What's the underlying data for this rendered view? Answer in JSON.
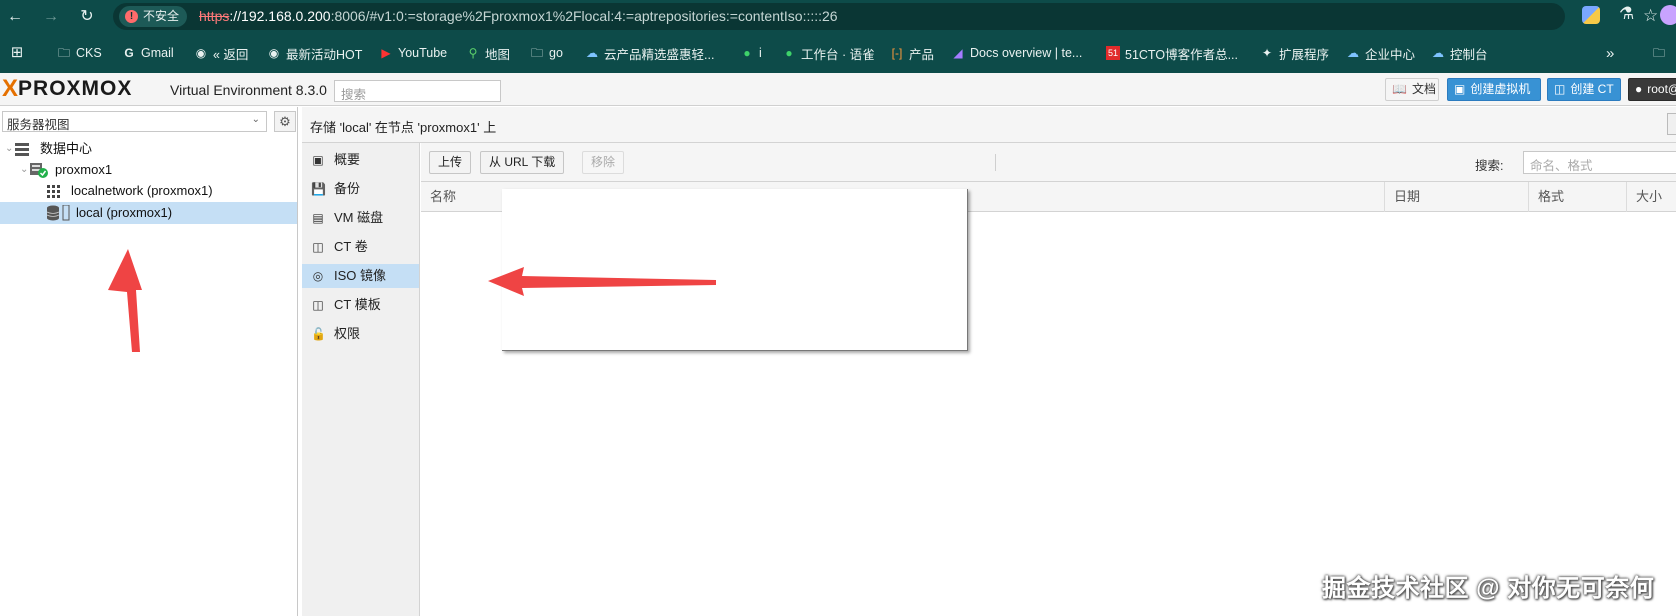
{
  "browser": {
    "security_label": "不安全",
    "url_scheme": "https",
    "url_host": "://192.168.0.200",
    "url_rest": ":8006/#v1:0:=storage%2Fproxmox1%2Flocal:4:=aptrepositories:=contentIso:::::26",
    "bookmarks": [
      {
        "label": "CKS",
        "icon": "folder-icon"
      },
      {
        "label": "Gmail",
        "icon": "google-icon"
      },
      {
        "label": "« 返回",
        "icon": "globe-icon"
      },
      {
        "label": "最新活动HOT",
        "icon": "globe-icon"
      },
      {
        "label": "YouTube",
        "icon": "youtube-icon"
      },
      {
        "label": "地图",
        "icon": "maps-pin-icon"
      },
      {
        "label": "go",
        "icon": "folder-icon"
      },
      {
        "label": "云产品精选盛惠轻...",
        "icon": "cloud-icon"
      },
      {
        "label": "i",
        "icon": "green-circle-icon"
      },
      {
        "label": "工作台 · 语雀",
        "icon": "yuque-icon"
      },
      {
        "label": "产品",
        "icon": "brackets-icon"
      },
      {
        "label": "Docs overview | te...",
        "icon": "terraform-icon"
      },
      {
        "label": "51CTO博客作者总...",
        "icon": "51cto-icon"
      },
      {
        "label": "扩展程序",
        "icon": "puzzle-icon"
      },
      {
        "label": "企业中心",
        "icon": "cloud-icon"
      },
      {
        "label": "控制台",
        "icon": "cloud-icon"
      }
    ],
    "more_label": "»"
  },
  "pve": {
    "logo_x": "X",
    "logo_word": "PROXMOX",
    "version": "Virtual Environment 8.3.0",
    "search_placeholder": "搜索",
    "docs_label": "文档",
    "create_vm_label": "创建虚拟机",
    "create_ct_label": "创建 CT",
    "user_label": "root@"
  },
  "tree": {
    "view_label": "服务器视图",
    "items": [
      {
        "label": "数据中心"
      },
      {
        "label": "proxmox1"
      },
      {
        "label": "localnetwork (proxmox1)"
      },
      {
        "label": "local (proxmox1)"
      }
    ]
  },
  "content": {
    "title": "存储 'local' 在节点 'proxmox1' 上",
    "nav": [
      {
        "label": "概要",
        "icon": "book-icon"
      },
      {
        "label": "备份",
        "icon": "floppy-icon"
      },
      {
        "label": "VM 磁盘",
        "icon": "hdd-icon"
      },
      {
        "label": "CT 卷",
        "icon": "ct-volume-icon"
      },
      {
        "label": "ISO 镜像",
        "icon": "disc-icon"
      },
      {
        "label": "CT 模板",
        "icon": "ct-template-icon"
      },
      {
        "label": "权限",
        "icon": "unlock-icon"
      }
    ],
    "toolbar": {
      "upload": "上传",
      "download_url": "从 URL 下载",
      "remove": "移除",
      "search_label": "搜索:",
      "search_placeholder": "命名、格式"
    },
    "columns": [
      "名称",
      "日期",
      "格式",
      "大小"
    ]
  },
  "watermark": "掘金技术社区 @ 对你无可奈何",
  "colors": {
    "chrome_bg": "#0d4b49",
    "selection": "#c5dff5",
    "primary_button": "#3892d4",
    "arrow_red": "#ef4444",
    "logo_orange": "#e57000"
  }
}
